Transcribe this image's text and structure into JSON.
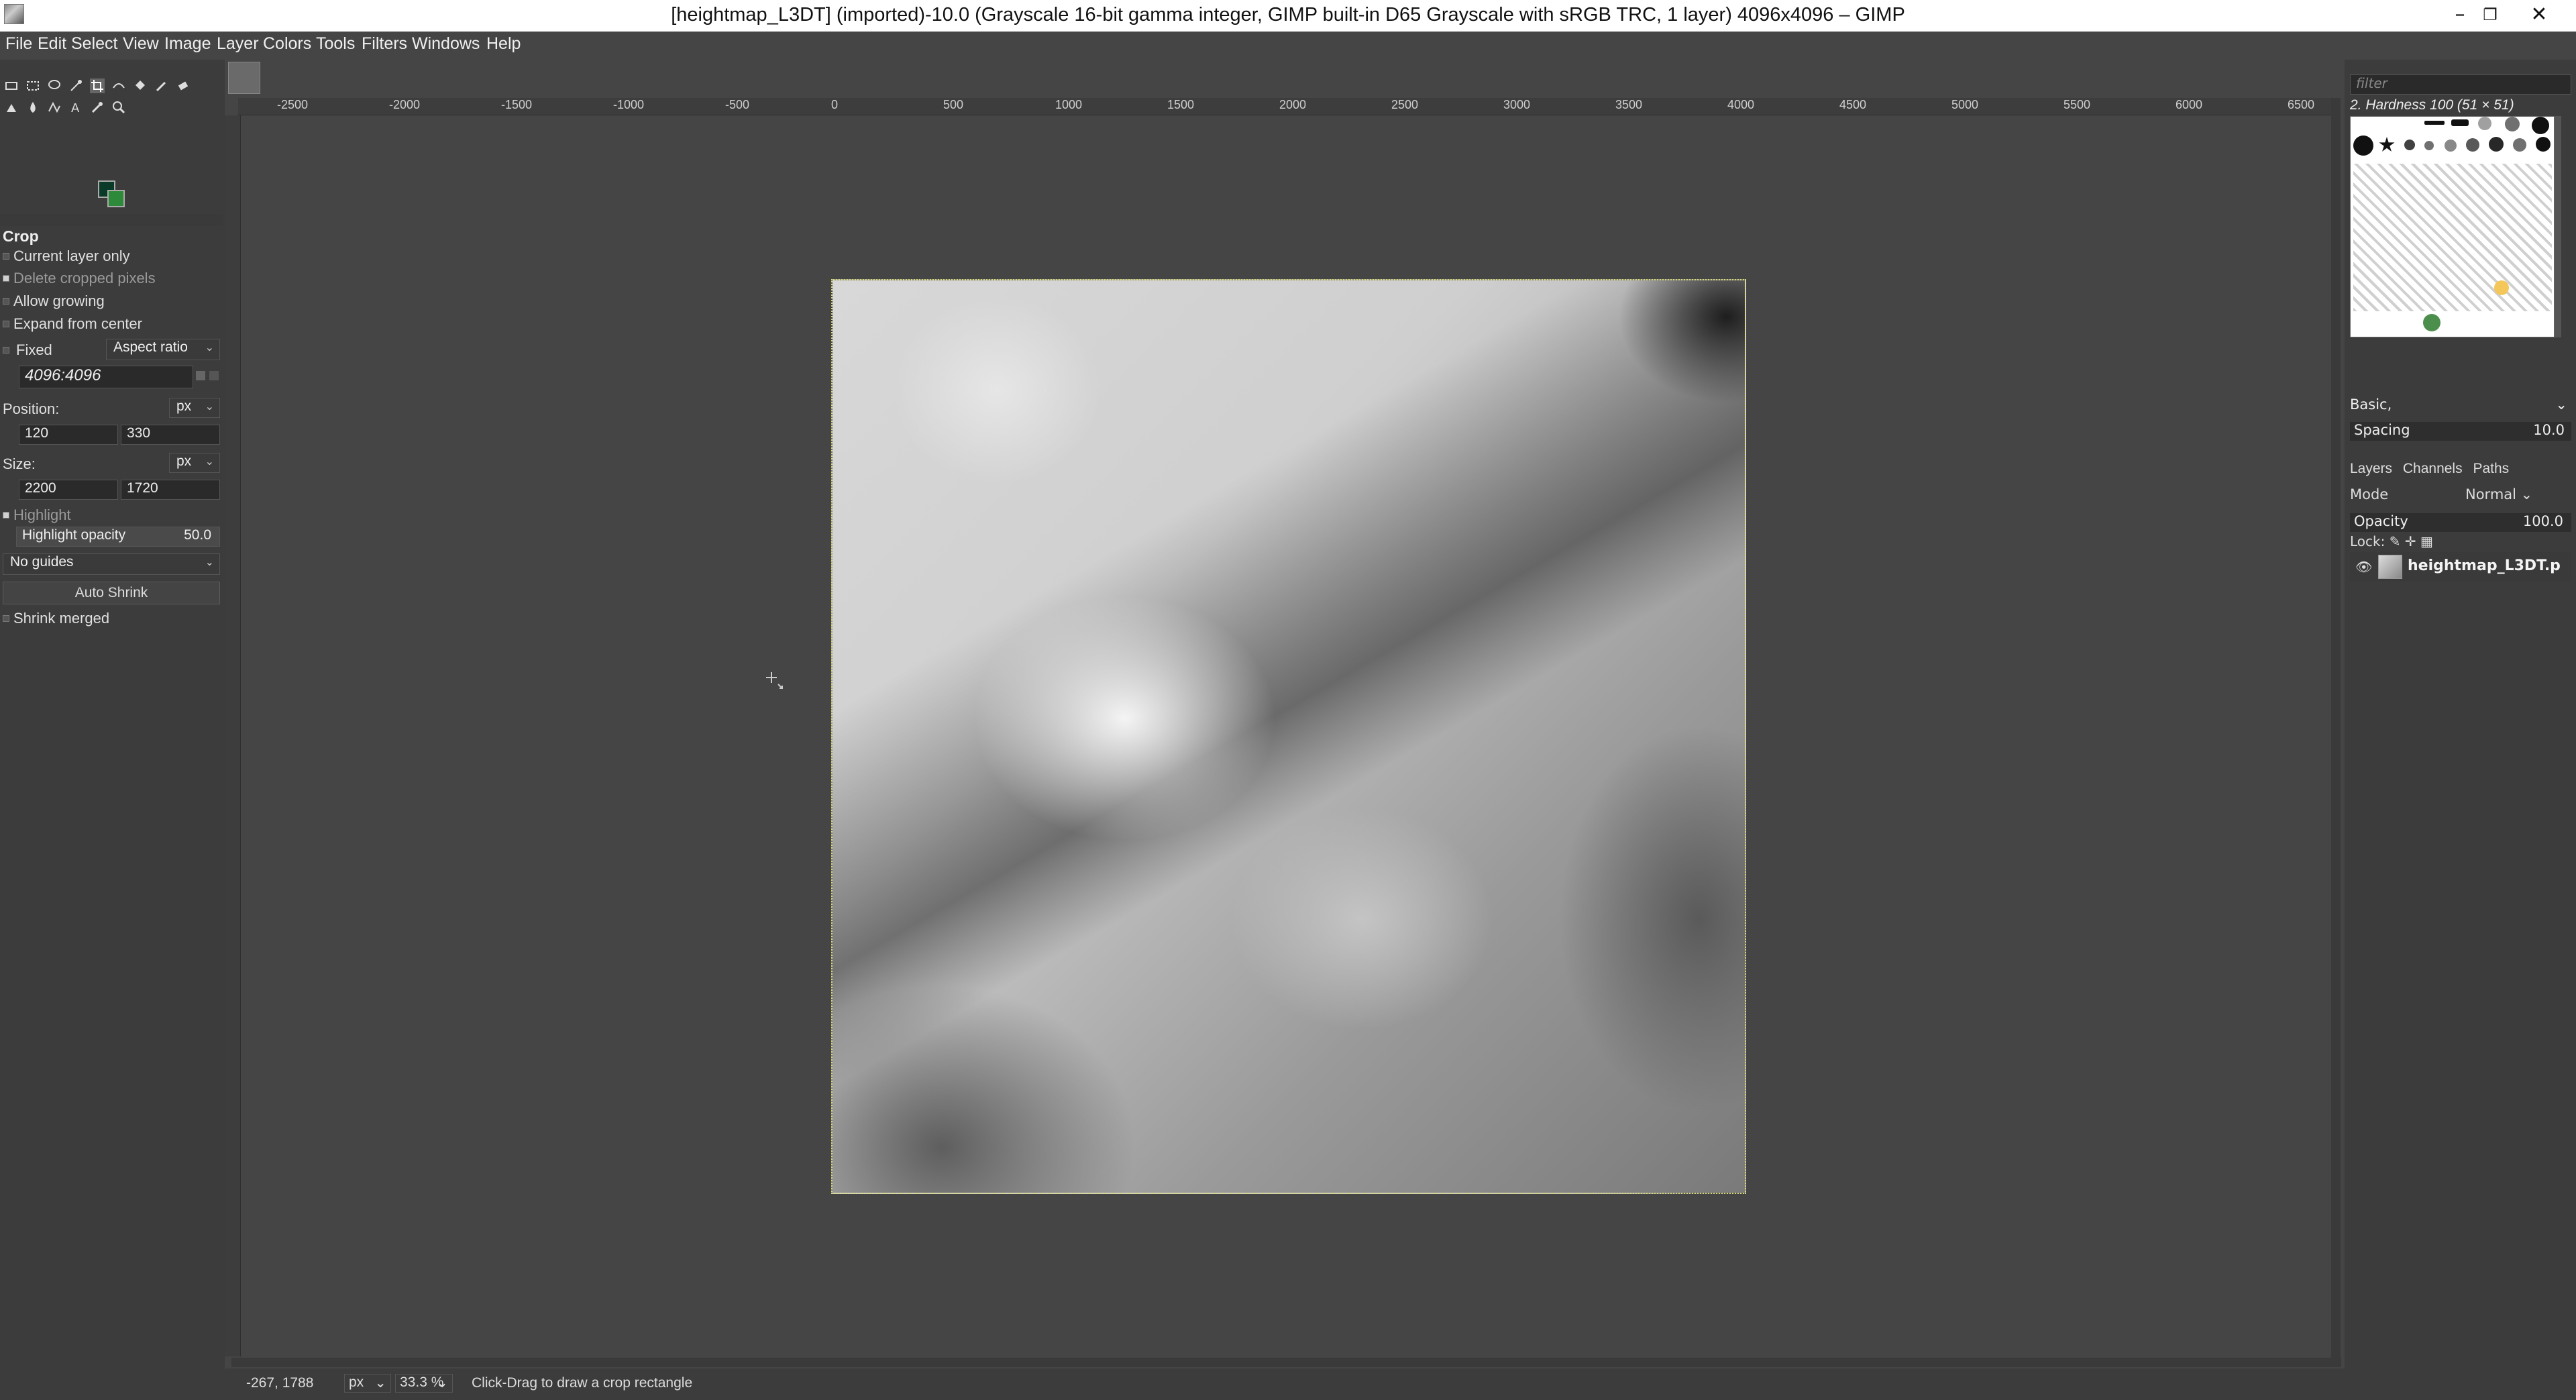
{
  "window": {
    "title": "[heightmap_L3DT] (imported)-10.0 (Grayscale 16-bit gamma integer, GIMP built-in D65 Grayscale with sRGB TRC, 1 layer) 4096x4096 – GIMP",
    "minimize": "–",
    "restore": "❐",
    "close": "✕"
  },
  "menubar": {
    "items": [
      "File",
      "Edit",
      "Select",
      "View",
      "Image",
      "Layer",
      "Colors",
      "Tools",
      "Filters",
      "Windows",
      "Help"
    ]
  },
  "tool_options": {
    "title": "Crop",
    "current_layer_only": "Current layer only",
    "delete_cropped_pixels": "Delete cropped pixels",
    "allow_growing": "Allow growing",
    "expand_from_center": "Expand from center",
    "fixed_label": "Fixed",
    "fixed_mode": "Aspect ratio",
    "aspect_value": "4096:4096",
    "position_label": "Position:",
    "position_unit": "px",
    "position_x": "120",
    "position_y": "330",
    "size_label": "Size:",
    "size_unit": "px",
    "size_w": "2200",
    "size_h": "1720",
    "highlight": "Highlight",
    "highlight_opacity_label": "Highlight opacity",
    "highlight_opacity_value": "50.0",
    "guides": "No guides",
    "auto_shrink": "Auto Shrink",
    "shrink_merged": "Shrink merged"
  },
  "ruler": {
    "h_labels": [
      "-2500",
      "-2000",
      "-1500",
      "-1000",
      "-500",
      "0",
      "500",
      "1000",
      "1500",
      "2000",
      "2500",
      "3000",
      "3500",
      "4000",
      "4500",
      "5000",
      "5500",
      "6000",
      "6500"
    ]
  },
  "status": {
    "coords": "-267, 1788",
    "unit": "px",
    "zoom": "33.3 %",
    "message": "Click-Drag to draw a crop rectangle"
  },
  "brushes": {
    "filter_placeholder": "filter",
    "selected": "2. Hardness 100 (51 × 51)",
    "preset": "Basic,",
    "spacing_label": "Spacing",
    "spacing_value": "10.0"
  },
  "layers": {
    "tabs": [
      "Layers",
      "Channels",
      "Paths"
    ],
    "mode_label": "Mode",
    "mode_value": "Normal",
    "opacity_label": "Opacity",
    "opacity_value": "100.0",
    "lock_label": "Lock:",
    "layer_name": "heightmap_L3DT.p"
  }
}
